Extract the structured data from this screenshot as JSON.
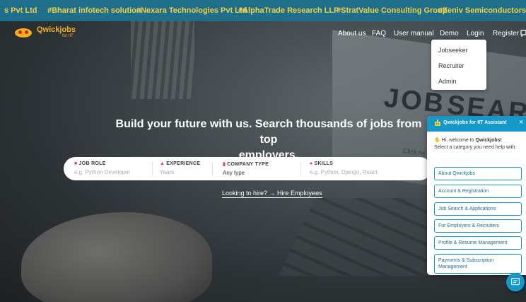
{
  "ticker": [
    "s Pvt Ltd",
    "#Bharat infotech solution",
    "#Nexara Technologies Pvt Ltd",
    "#AlphaTrade Research LLP",
    "#StratValue Consulting Group",
    "#Zeniv Semiconductors Pvt L"
  ],
  "brand": {
    "name": "Qwickjobs",
    "sub": "for IIT"
  },
  "nav": {
    "about": "About us",
    "faq": "FAQ",
    "manual": "User manual",
    "demo": "Demo",
    "login": "Login",
    "register": "Register"
  },
  "demo_menu": [
    "Jobseeker",
    "Recruiter",
    "Admin"
  ],
  "hero": {
    "background_words": {
      "job": "JOB",
      "search": "SEARC",
      "click": "Click he"
    },
    "headline_line1": "Build your future with us. Search thousands of jobs from top",
    "headline_line2": "employers."
  },
  "search": {
    "job_role": {
      "label": "JOB ROLE",
      "value": "e.g. Python Developer"
    },
    "experience": {
      "label": "EXPERIENCE",
      "value": "Years"
    },
    "company_type": {
      "label": "COMPANY TYPE",
      "value": "Any type"
    },
    "skills": {
      "label": "SKILLS",
      "value": "e.g. Python, Django, React"
    }
  },
  "hire_link": "Looking to hire? → Hire Employees",
  "chat": {
    "title": "Qwickjobs for IIT Assistant",
    "greeting_prefix": "Hi, welcome to",
    "greeting_brand": "Qwickjobs!",
    "greeting_rest": "Select a category you need help with:",
    "options": [
      "About Qwickjobs",
      "Account & Registration",
      "Job Search & Applications",
      "For Employers & Recruiters",
      "Profile & Resume Management",
      "Payments & Subscription Management"
    ]
  },
  "colors": {
    "ticker_bg": "#1f6f8b",
    "ticker_text": "#f5d142",
    "brand": "#f5b21a",
    "chat_accent": "#1598c9",
    "label_icon": "#e5347a"
  }
}
